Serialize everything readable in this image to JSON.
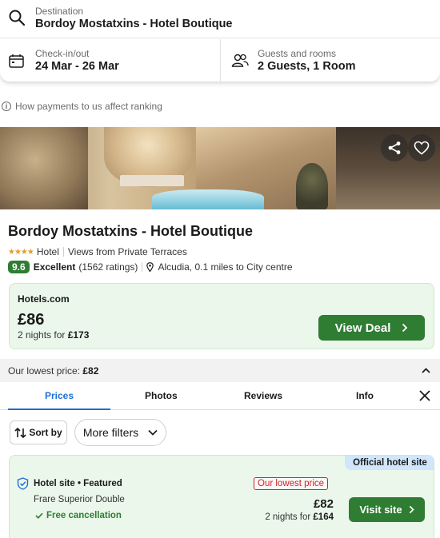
{
  "search": {
    "destination_label": "Destination",
    "destination_value": "Bordoy Mostatxins - Hotel Boutique",
    "checkin_label": "Check-in/out",
    "checkin_value": "24 Mar - 26 Mar",
    "guests_label": "Guests and rooms",
    "guests_value": "2 Guests, 1 Room"
  },
  "ranking_note": "How payments to us affect ranking",
  "hero": {
    "image_desc_icon": "share-icon",
    "fav_icon": "heart-icon"
  },
  "hotel": {
    "name": "Bordoy Mostatxins - Hotel Boutique",
    "stars": 4,
    "type": "Hotel",
    "feature": "Views from Private Terraces",
    "score": "9.6",
    "rating_word": "Excellent",
    "ratings_count": "(1562 ratings)",
    "location": "Alcudia, 0.1 miles to City centre"
  },
  "deal": {
    "provider": "Hotels.com",
    "price": "£86",
    "nights_prefix": "2 nights for ",
    "nights_total": "£173",
    "button": "View Deal"
  },
  "lowest_price": {
    "label": "Our lowest price: ",
    "value": "£82"
  },
  "tabs": [
    "Prices",
    "Photos",
    "Reviews",
    "Info"
  ],
  "filters": {
    "sort": "Sort by",
    "more": "More filters"
  },
  "offer": {
    "tag": "Official hotel site",
    "source": "Hotel site • Featured",
    "room": "Frare Superior Double",
    "cancellation": "Free cancellation",
    "badge": "Our lowest price",
    "price": "£82",
    "nights_prefix": "2 nights for ",
    "nights_total": "£164",
    "button": "Visit site"
  },
  "colors": {
    "brand_green": "#2e7d32",
    "accent_blue": "#1f6fd6",
    "badge_red": "#c62828"
  }
}
